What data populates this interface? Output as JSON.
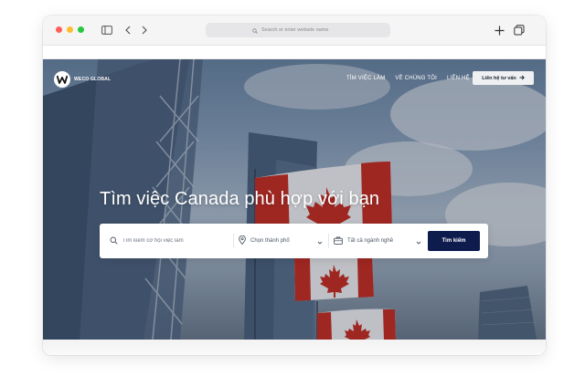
{
  "browser": {
    "address_placeholder": "Search or enter website name",
    "icons": [
      "sidebar-icon",
      "chevron-left-icon",
      "chevron-right-icon",
      "plus-icon",
      "tabs-icon",
      "search-icon"
    ]
  },
  "site": {
    "logo_text": "WECO GLOBAL",
    "nav": [
      {
        "label": "TÌM VIỆC LÀM"
      },
      {
        "label": "VỀ CHÚNG TÔI"
      },
      {
        "label": "LIÊN HỆ"
      }
    ],
    "cta_label": "Liên hệ tư vấn",
    "cta_icon": "arrow-right-icon"
  },
  "hero": {
    "headline": "Tìm việc Canada phù hợp với bạn"
  },
  "search": {
    "keyword_placeholder": "Tìm kiếm cơ hội việc làm",
    "city_label": "Chọn thành phố",
    "industry_label": "Tất cả ngành nghề",
    "button_label": "Tìm kiếm"
  },
  "colors": {
    "accent_navy": "#0e1b4d",
    "flag_red": "#d52b1e"
  }
}
